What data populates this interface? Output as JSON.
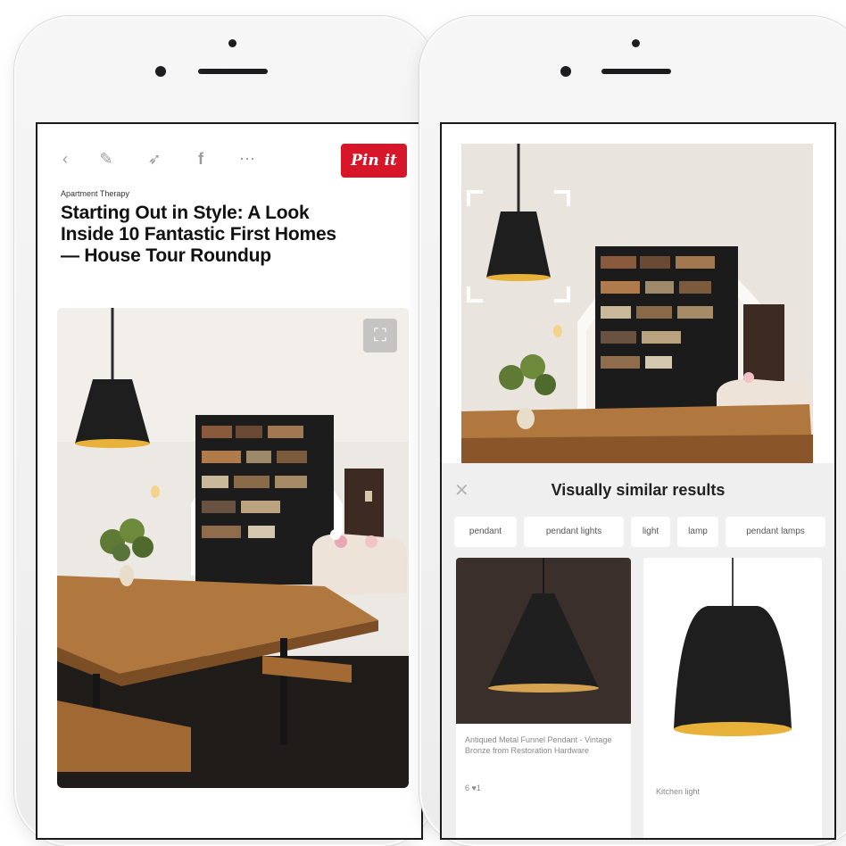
{
  "left_phone": {
    "toolbar": {
      "icons": [
        "back-chevron-icon",
        "edit-pencil-icon",
        "send-icon",
        "facebook-icon",
        "more-icon"
      ],
      "pin_it_label": "Pin it"
    },
    "source": "Apartment Therapy",
    "title": "Starting Out in Style: A Look Inside 10 Fantastic First Homes — House Tour Roundup"
  },
  "right_phone": {
    "results": {
      "title": "Visually similar results",
      "chips": [
        "pendant",
        "pendant lights",
        "light",
        "lamp",
        "pendant lamps"
      ],
      "cards": [
        {
          "caption": "Antiqued Metal Funnel Pendant - Vintage Bronze from Restoration Hardware",
          "meta": "6 ♥1"
        },
        {
          "caption": "Kitchen light"
        }
      ]
    }
  },
  "colors": {
    "pin_red": "#d8162a",
    "lamp_black": "#1e1e1e",
    "lamp_gold": "#e8b13a"
  }
}
